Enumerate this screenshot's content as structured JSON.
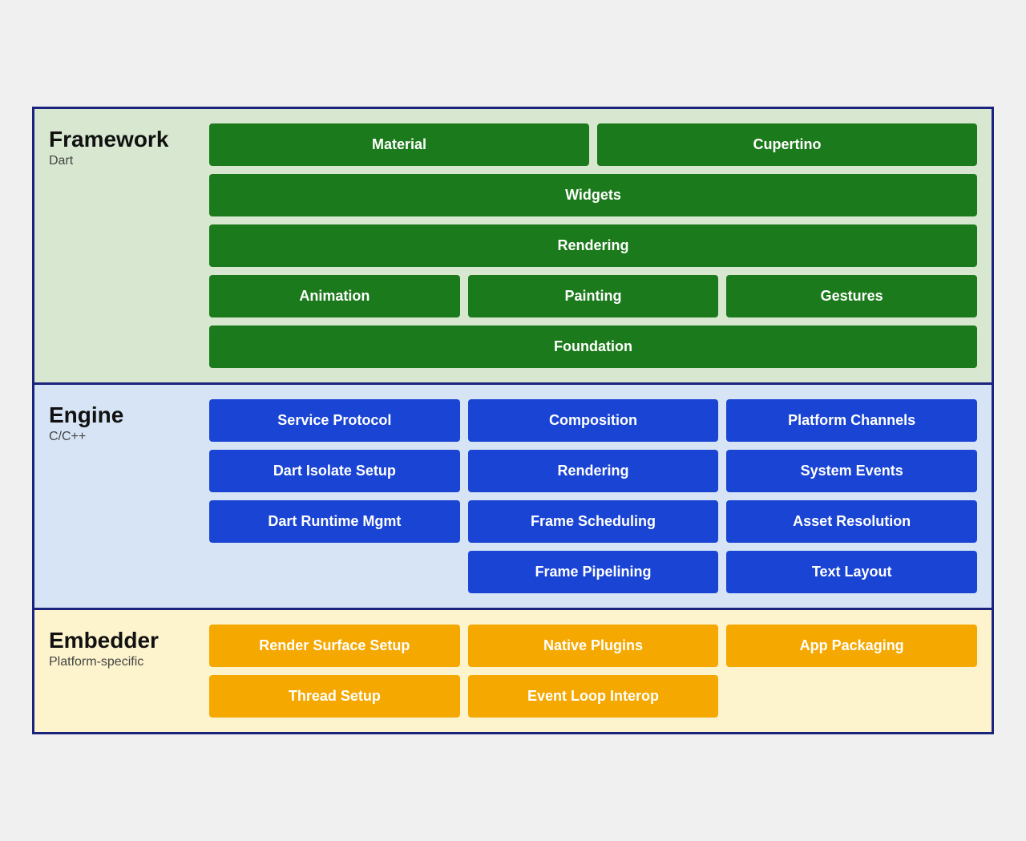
{
  "framework": {
    "title": "Framework",
    "subtitle": "Dart",
    "rows": [
      [
        {
          "label": "Material",
          "span": 1
        },
        {
          "label": "Cupertino",
          "span": 1
        }
      ],
      [
        {
          "label": "Widgets",
          "span": 2
        }
      ],
      [
        {
          "label": "Rendering",
          "span": 2
        }
      ],
      [
        {
          "label": "Animation",
          "span": 1
        },
        {
          "label": "Painting",
          "span": 1
        },
        {
          "label": "Gestures",
          "span": 1
        }
      ],
      [
        {
          "label": "Foundation",
          "span": 3
        }
      ]
    ]
  },
  "engine": {
    "title": "Engine",
    "subtitle": "C/C++",
    "rows": [
      [
        {
          "label": "Service Protocol"
        },
        {
          "label": "Composition"
        },
        {
          "label": "Platform Channels"
        }
      ],
      [
        {
          "label": "Dart Isolate Setup"
        },
        {
          "label": "Rendering"
        },
        {
          "label": "System Events"
        }
      ],
      [
        {
          "label": "Dart Runtime Mgmt"
        },
        {
          "label": "Frame Scheduling"
        },
        {
          "label": "Asset Resolution"
        }
      ],
      [
        {
          "label": "",
          "empty": true
        },
        {
          "label": "Frame Pipelining"
        },
        {
          "label": "Text Layout"
        }
      ]
    ]
  },
  "embedder": {
    "title": "Embedder",
    "subtitle": "Platform-specific",
    "rows": [
      [
        {
          "label": "Render Surface Setup"
        },
        {
          "label": "Native Plugins"
        },
        {
          "label": "App Packaging"
        }
      ],
      [
        {
          "label": "Thread Setup"
        },
        {
          "label": "Event Loop Interop"
        },
        {
          "label": "",
          "empty": true
        }
      ]
    ]
  }
}
